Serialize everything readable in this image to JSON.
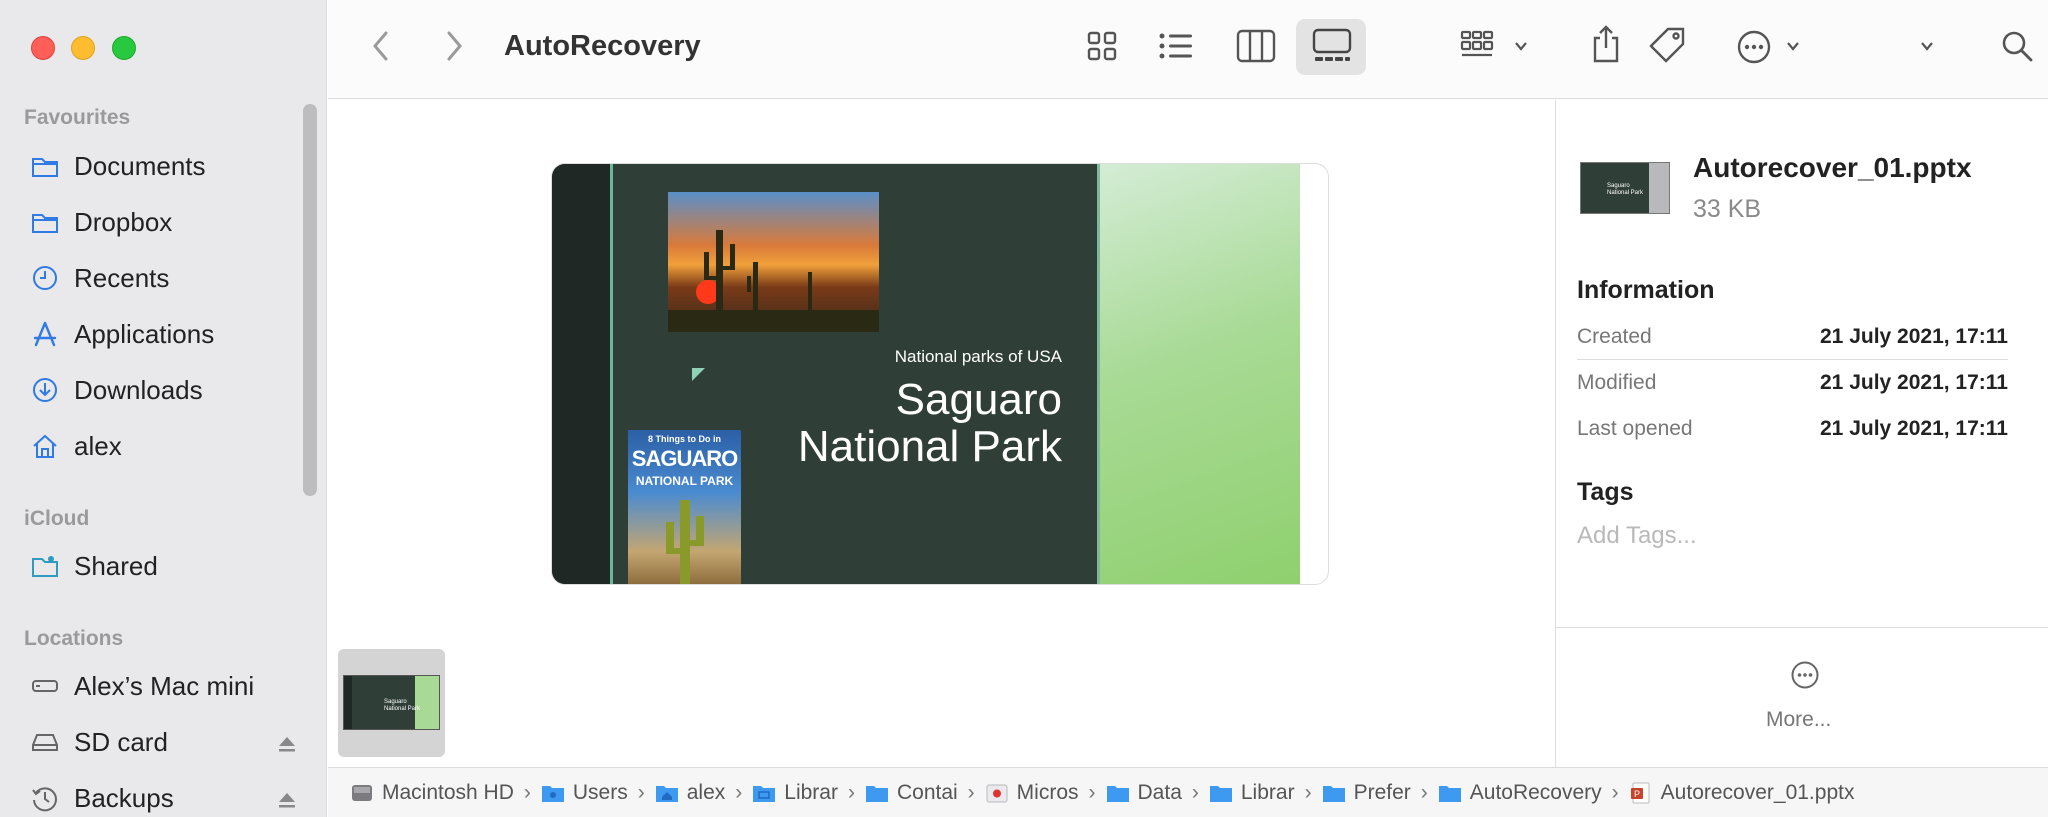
{
  "window": {
    "title": "AutoRecovery"
  },
  "sidebar": {
    "sections": [
      {
        "label": "Favourites"
      },
      {
        "label": "iCloud"
      },
      {
        "label": "Locations"
      }
    ],
    "favourites": [
      {
        "label": "Documents",
        "icon": "folder-icon"
      },
      {
        "label": "Dropbox",
        "icon": "folder-icon"
      },
      {
        "label": "Recents",
        "icon": "clock-icon"
      },
      {
        "label": "Applications",
        "icon": "applications-icon"
      },
      {
        "label": "Downloads",
        "icon": "download-icon"
      },
      {
        "label": "alex",
        "icon": "home-icon"
      }
    ],
    "icloud": [
      {
        "label": "Shared",
        "icon": "shared-folder-icon"
      }
    ],
    "locations": [
      {
        "label": "Alex’s Mac mini",
        "icon": "computer-icon"
      },
      {
        "label": "SD card",
        "icon": "drive-icon"
      },
      {
        "label": "Backups",
        "icon": "time-machine-icon"
      }
    ],
    "accent": "#2f7ae5"
  },
  "preview": {
    "slide_subtitle": "National parks of USA",
    "slide_title_line1": "Saguaro",
    "slide_title_line2": "National Park",
    "book_line1": "8 Things to Do in",
    "book_line2": "SAGUARO",
    "book_line3": "NATIONAL PARK"
  },
  "inspector": {
    "file_name": "Autorecover_01.pptx",
    "file_size": "33 KB",
    "information_heading": "Information",
    "rows": [
      {
        "key": "Created",
        "value": "21 July 2021, 17:11"
      },
      {
        "key": "Modified",
        "value": "21 July 2021, 17:11"
      },
      {
        "key": "Last opened",
        "value": "21 July 2021, 17:11"
      }
    ],
    "tags_heading": "Tags",
    "tags_placeholder": "Add Tags...",
    "more_label": "More..."
  },
  "pathbar": [
    "Macintosh HD",
    "Users",
    "alex",
    "Library",
    "Containers",
    "Microsoft",
    "Data",
    "Library",
    "Preferences",
    "AutoRecovery",
    "Autorecover_01.pptx"
  ],
  "pathbar_display": [
    "Macintosh HD",
    "Users",
    "alex",
    "Librar",
    "Contai",
    "Micros",
    "Data",
    "Librar",
    "Prefer",
    "AutoRecovery",
    "Autorecover_01.pptx"
  ]
}
